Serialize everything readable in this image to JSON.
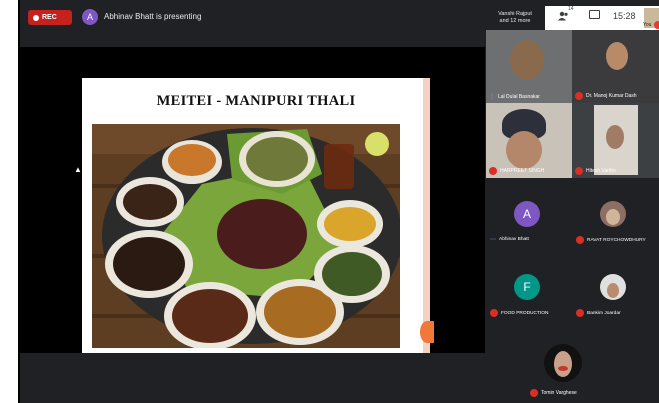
{
  "topbar": {
    "rec_label": "REC",
    "presenter_initial": "A",
    "presenter_text": "Abhinav Bhatt is presenting",
    "others_text_line1": "Vanshi Rajput",
    "others_text_line2": "and 12 more",
    "people_count": "14",
    "time": "15:28",
    "self_label": "You"
  },
  "slide": {
    "title": "MEITEI - MANIPURI THALI"
  },
  "participants": {
    "video_tiles": [
      {
        "name": "Lal Dulal Basnakar",
        "speaking": true
      },
      {
        "name": "Dr. Manoj Kumar Dash",
        "speaking": false
      },
      {
        "name": "HARPREET SINGH",
        "speaking": false
      },
      {
        "name": "Hitesh Vartho",
        "speaking": false
      }
    ],
    "grid": [
      {
        "initial": "A",
        "name": "Abhinav Bhatt",
        "color": "#7e57c2",
        "status": "speaking"
      },
      {
        "initial": "",
        "name": "RAVAT ROYCHOWDHURY",
        "color": "#8d6e63",
        "status": "muted"
      },
      {
        "initial": "F",
        "name": "FOOD PRODUCTION",
        "color": "#009688",
        "status": "muted"
      },
      {
        "initial": "",
        "name": "Bankim Joardar",
        "color": "#e0e0e0",
        "status": "muted"
      }
    ],
    "last": {
      "name": "Tomin Varghese"
    }
  },
  "colors": {
    "background": "#202124",
    "rec": "#c5221f",
    "muted": "#d93025"
  }
}
